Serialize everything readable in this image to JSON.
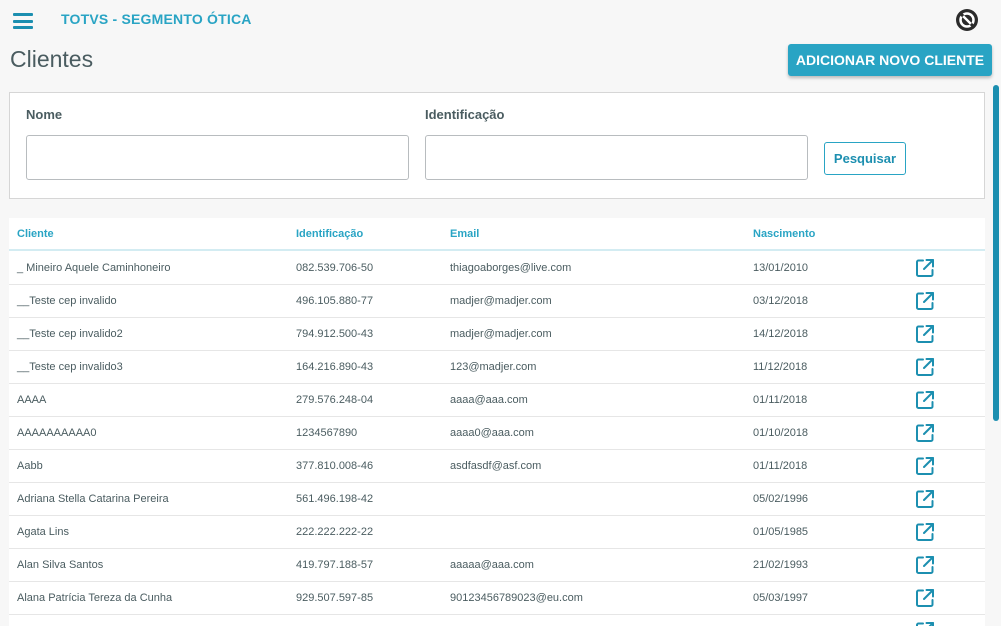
{
  "header": {
    "app_title": "TOTVS - SEGMENTO ÓTICA"
  },
  "page": {
    "title": "Clientes",
    "add_button_label": "ADICIONAR NOVO CLIENTE"
  },
  "filters": {
    "name_label": "Nome",
    "name_value": "",
    "id_label": "Identificação",
    "id_value": "",
    "search_label": "Pesquisar"
  },
  "table": {
    "columns": [
      "Cliente",
      "Identificação",
      "Email",
      "Nascimento"
    ],
    "rows": [
      {
        "cliente": "_ Mineiro Aquele Caminhoneiro",
        "id": "082.539.706-50",
        "email": "thiagoaborges@live.com",
        "nascimento": "13/01/2010"
      },
      {
        "cliente": "__Teste cep invalido",
        "id": "496.105.880-77",
        "email": "madjer@madjer.com",
        "nascimento": "03/12/2018"
      },
      {
        "cliente": "__Teste cep invalido2",
        "id": "794.912.500-43",
        "email": "madjer@madjer.com",
        "nascimento": "14/12/2018"
      },
      {
        "cliente": "__Teste cep invalido3",
        "id": "164.216.890-43",
        "email": "123@madjer.com",
        "nascimento": "11/12/2018"
      },
      {
        "cliente": "AAAA",
        "id": "279.576.248-04",
        "email": "aaaa@aaa.com",
        "nascimento": "01/11/2018"
      },
      {
        "cliente": "AAAAAAAAAA0",
        "id": "1234567890",
        "email": "aaaa0@aaa.com",
        "nascimento": "01/10/2018"
      },
      {
        "cliente": "Aabb",
        "id": "377.810.008-46",
        "email": "asdfasdf@asf.com",
        "nascimento": "01/11/2018"
      },
      {
        "cliente": "Adriana Stella Catarina Pereira",
        "id": "561.496.198-42",
        "email": "",
        "nascimento": "05/02/1996"
      },
      {
        "cliente": "Agata Lins",
        "id": "222.222.222-22",
        "email": "",
        "nascimento": "01/05/1985"
      },
      {
        "cliente": "Alan Silva Santos",
        "id": "419.797.188-57",
        "email": "aaaaa@aaa.com",
        "nascimento": "21/02/1993"
      },
      {
        "cliente": "Alana Patrícia Tereza da Cunha",
        "id": "929.507.597-85",
        "email": "90123456789023@eu.com",
        "nascimento": "05/03/1997"
      },
      {
        "cliente": "",
        "id": "",
        "email": "",
        "nascimento": ""
      }
    ]
  },
  "colors": {
    "accent": "#29a4c4",
    "accent_dark": "#1c8fb0",
    "text": "#4a5c60"
  },
  "icons": {
    "menu": "hamburger-menu-icon",
    "logo": "totvs-logo-icon",
    "row_action": "open-external-icon"
  }
}
